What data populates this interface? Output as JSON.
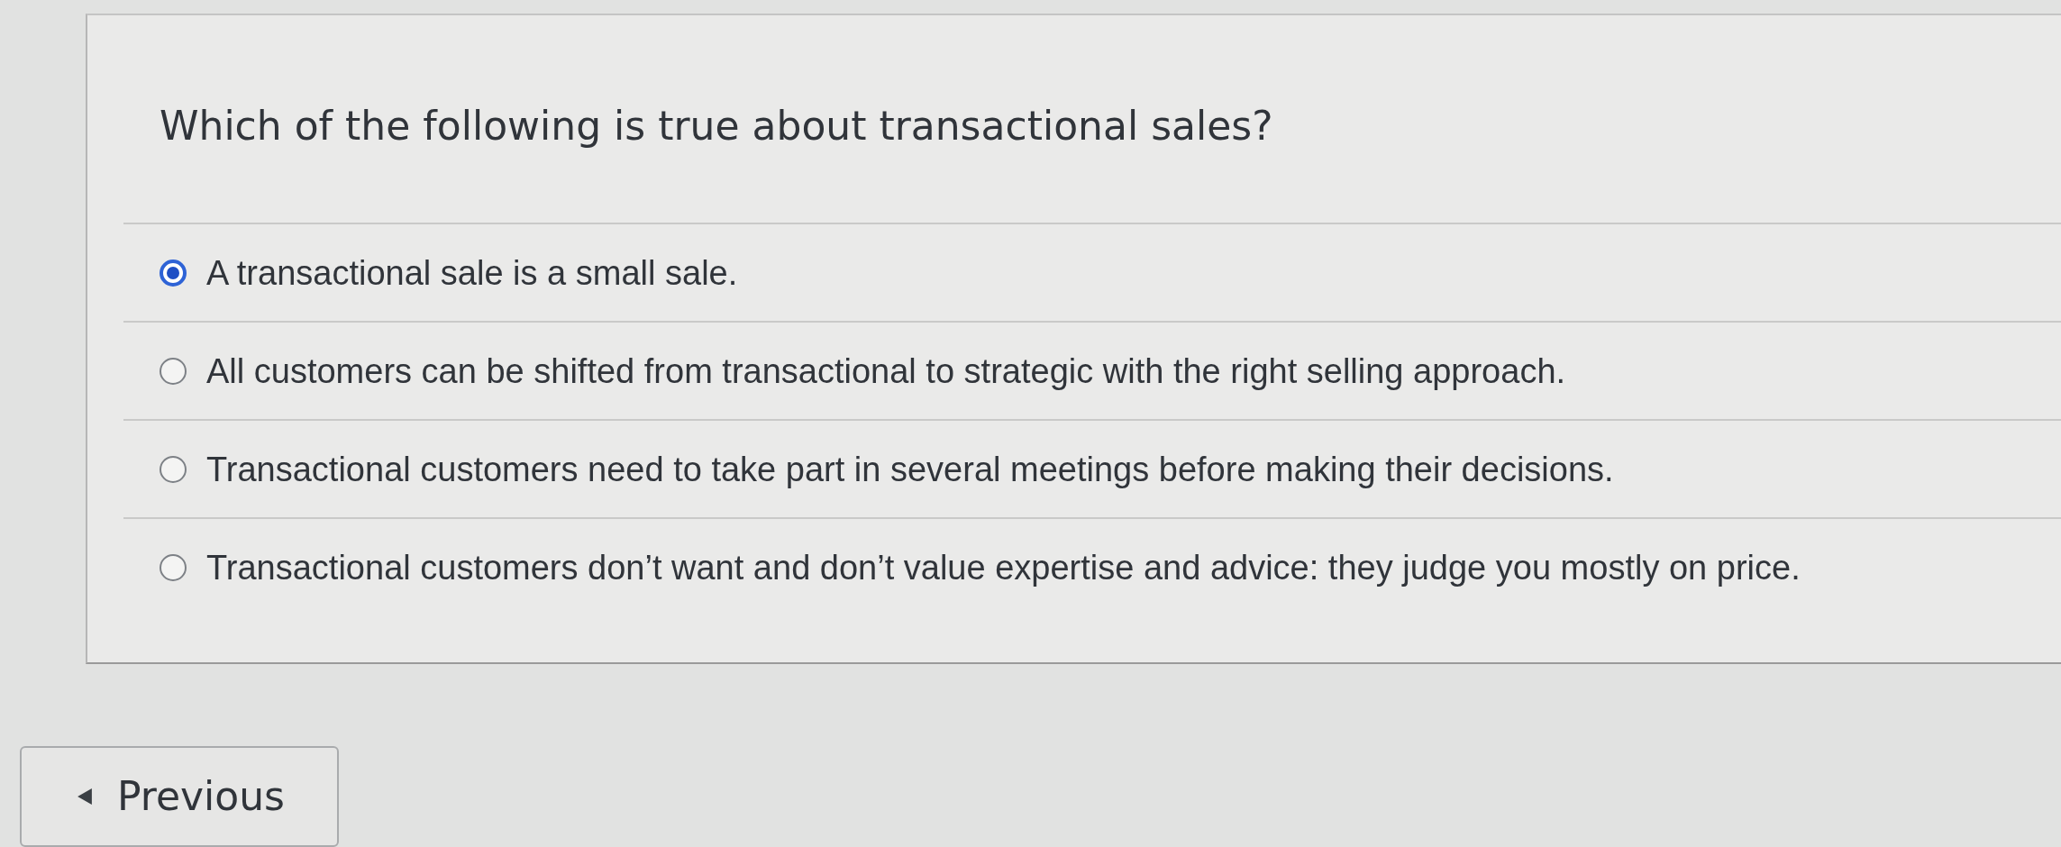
{
  "question": {
    "text": "Which of the following is true about transactional sales?"
  },
  "options": [
    {
      "label": "A transactional sale is a small sale.",
      "selected": true
    },
    {
      "label": "All customers can be shifted from transactional to strategic with the right selling approach.",
      "selected": false
    },
    {
      "label": "Transactional customers need to take part in several meetings before making their decisions.",
      "selected": false
    },
    {
      "label": "Transactional customers don’t want and don’t value expertise and advice: they judge you mostly on price.",
      "selected": false
    }
  ],
  "navigation": {
    "previous_button": {
      "label": "Previous"
    }
  }
}
